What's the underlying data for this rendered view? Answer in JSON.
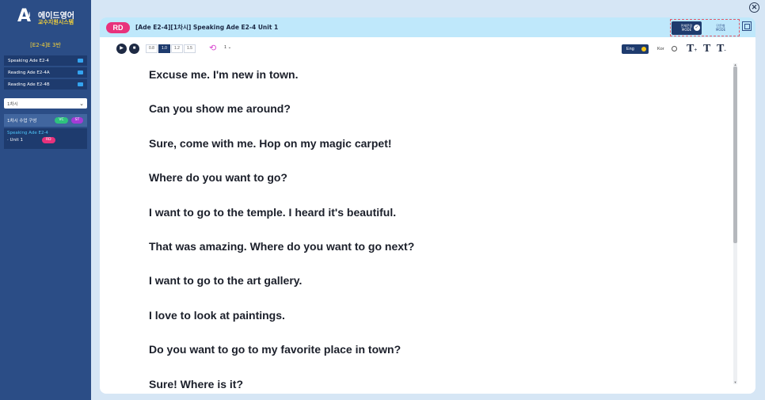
{
  "sidebar": {
    "logo_mark": "A",
    "logo_i": "i",
    "logo_title": "에이드영어",
    "logo_subtitle": "교수지원시스템",
    "grade": "[E2-4]E 3반",
    "books": [
      {
        "label": "Speaking Ade E2-4"
      },
      {
        "label": "Reading Ade E2-4A"
      },
      {
        "label": "Reading Ade E2-4B"
      }
    ],
    "session_select": "1차시",
    "lesson_label": "1차시 수업 구성",
    "lesson_pills": {
      "vc": "VC",
      "st": "ST"
    },
    "unit_title": "Speaking Ade E2-4",
    "unit_sub": "· Unit 1",
    "unit_pill": "RD"
  },
  "header": {
    "badge": "RD",
    "title": "[Ade E2-4][1차시] Speaking Ade E2-4 Unit 1",
    "mode_on_line1": "전체문장",
    "mode_on_line2": "MODE",
    "mode_off_line1": "단문형",
    "mode_off_line2": "MODE"
  },
  "toolbar": {
    "speeds": [
      "0.8",
      "1.0",
      "1.2",
      "1.5"
    ],
    "active_speed": "1.0",
    "repeat_count": "1",
    "eng_label": "Eng",
    "kor_label": "Kor",
    "font_larger": "T",
    "font_normal": "T",
    "font_smaller": "T",
    "plus": "+",
    "minus": "-"
  },
  "sentences": [
    "Excuse me. I'm new in town.",
    "Can you show me around?",
    "Sure, come with me. Hop on my magic carpet!",
    "Where do you want to go?",
    "I want to go to the temple. I heard it's beautiful.",
    "That was amazing. Where do you want to go next?",
    "I want to go to the art gallery.",
    "I love to look at paintings.",
    "Do you want to go to my favorite place in town?",
    "Sure! Where is it?"
  ],
  "colors": {
    "sidebar_bg": "#2b4d86",
    "header_bg": "#bfe8fb",
    "badge": "#e8327c",
    "accent_yellow": "#f5d23a"
  }
}
